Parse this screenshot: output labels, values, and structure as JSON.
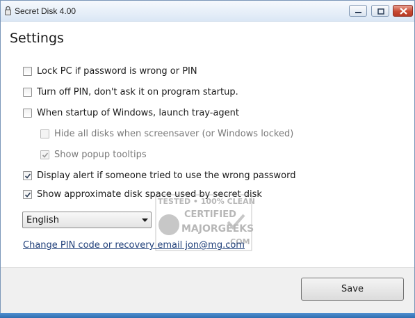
{
  "window": {
    "title": "Secret Disk 4.00",
    "controls": {
      "minimize_icon": "minimize-icon",
      "maximize_icon": "maximize-icon",
      "close_icon": "close-icon"
    }
  },
  "settings": {
    "title": "Settings",
    "options": [
      {
        "label": "Lock PC if password is wrong or PIN",
        "checked": false,
        "enabled": true
      },
      {
        "label": "Turn off PIN, don't ask it on program startup.",
        "checked": false,
        "enabled": true
      },
      {
        "label": "When startup of Windows, launch tray-agent",
        "checked": false,
        "enabled": true
      },
      {
        "label": "Hide all disks when screensaver (or Windows locked)",
        "checked": false,
        "enabled": false
      },
      {
        "label": "Show popup tooltips",
        "checked": true,
        "enabled": false
      },
      {
        "label": "Display alert if someone tried to use the wrong password",
        "checked": true,
        "enabled": true
      },
      {
        "label": "Show approximate disk space used by secret disk",
        "checked": true,
        "enabled": true
      }
    ],
    "language": {
      "selected": "English"
    },
    "change_pin_link": "Change PIN code or recovery email jon@mg.com"
  },
  "footer": {
    "save_label": "Save"
  },
  "watermark": {
    "line1": "TESTED • 100% CLEAN",
    "line2": "CERTIFIED",
    "line3": "MAJORGEEKS",
    "line4": ".COM"
  },
  "colors": {
    "titlebar": "#dbe7f5",
    "close_button": "#c84a33",
    "footer": "#f0f0f0",
    "link": "#1f3f7a"
  }
}
